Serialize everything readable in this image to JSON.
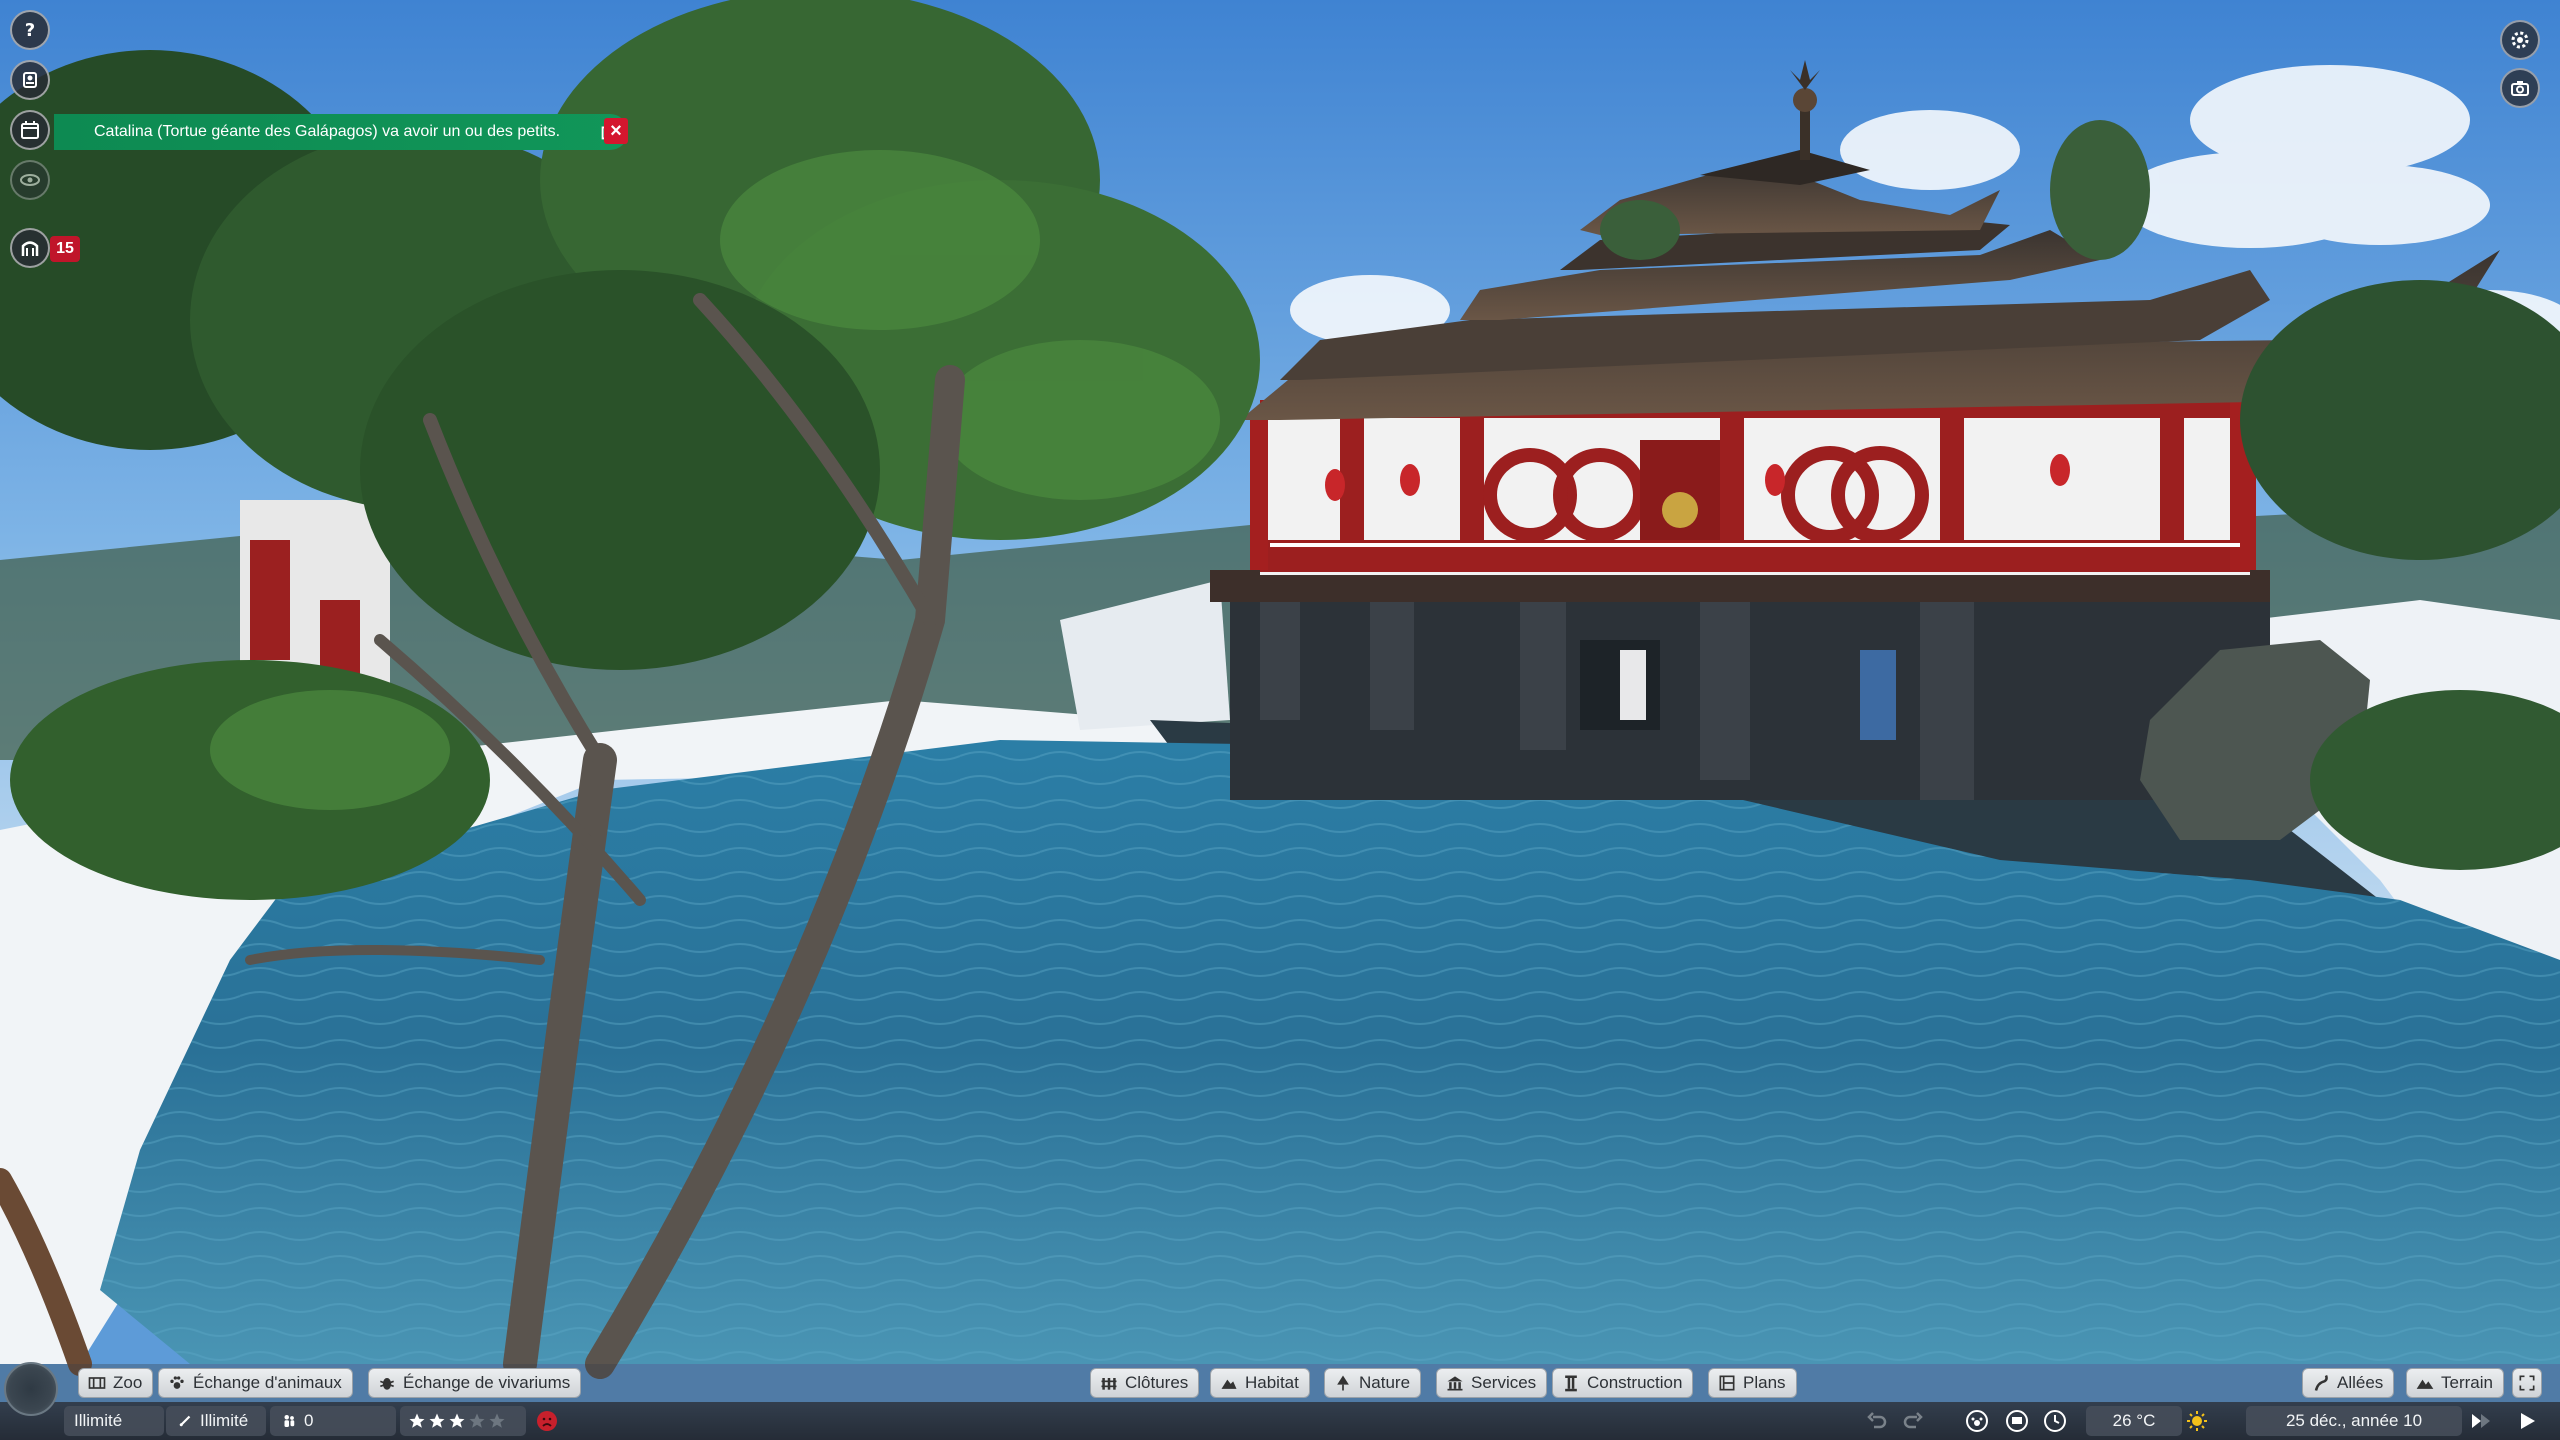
{
  "notification": {
    "text": "Catalina (Tortue géante des Galápagos) va avoir un ou des petits."
  },
  "left_hud": {
    "guest_count": "15"
  },
  "toolbar": {
    "left": [
      {
        "id": "zoo",
        "label": "Zoo",
        "icon": "zoo-icon"
      },
      {
        "id": "animal-trade",
        "label": "Échange d'animaux",
        "icon": "paw-icon"
      },
      {
        "id": "exhibit-trade",
        "label": "Échange de vivariums",
        "icon": "bug-icon"
      }
    ],
    "center": [
      {
        "id": "barriers",
        "label": "Clôtures",
        "icon": "fence-icon"
      },
      {
        "id": "habitat",
        "label": "Habitat",
        "icon": "habitat-icon"
      },
      {
        "id": "nature",
        "label": "Nature",
        "icon": "tree-icon"
      },
      {
        "id": "facilities",
        "label": "Services",
        "icon": "building-icon"
      },
      {
        "id": "construction",
        "label": "Construction",
        "icon": "pillar-icon"
      },
      {
        "id": "blueprints",
        "label": "Plans",
        "icon": "blueprint-icon"
      }
    ],
    "right": [
      {
        "id": "paths",
        "label": "Allées",
        "icon": "path-icon"
      },
      {
        "id": "terrain",
        "label": "Terrain",
        "icon": "mountain-icon"
      }
    ]
  },
  "status": {
    "money": "Illimité",
    "research": "Illimité",
    "guests": "0",
    "rating_stars": 3,
    "rating_max": 5,
    "temperature": "26 °C",
    "date": "25 déc., année 10"
  },
  "colors": {
    "notification_green": "#119659",
    "close_red": "#d4162e",
    "badge_red": "#c0152a"
  }
}
